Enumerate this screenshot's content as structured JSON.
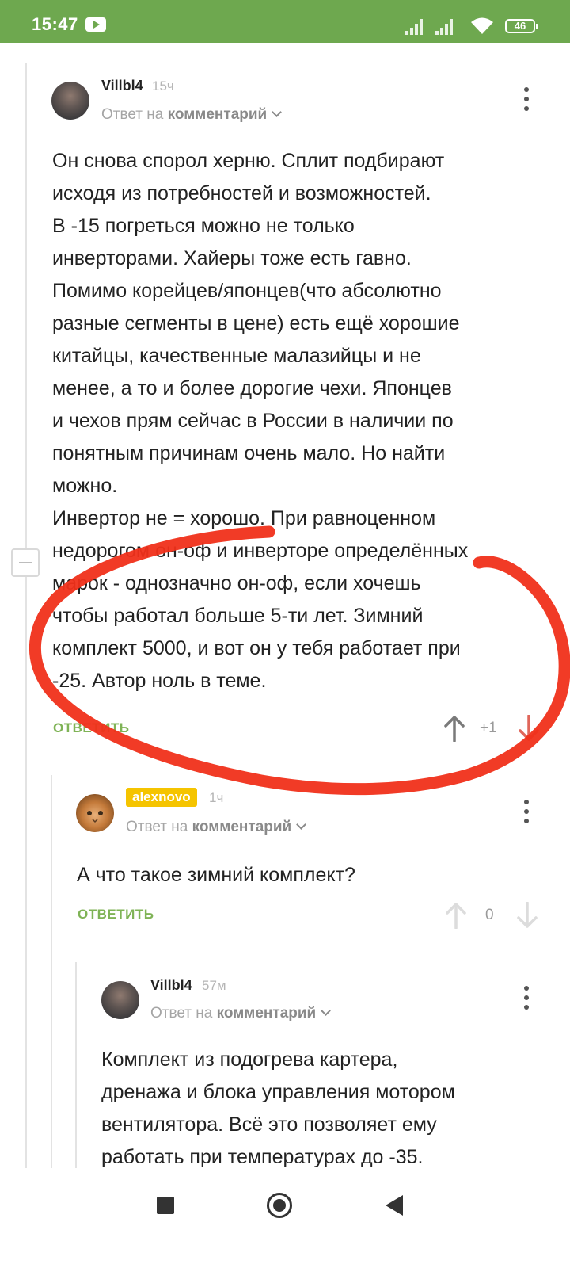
{
  "status_bar": {
    "time": "15:47",
    "battery": "46"
  },
  "comments": [
    {
      "username": "Villbl4",
      "time_ago": "15ч",
      "reply_prefix": "Ответ на",
      "reply_target": "комментарий",
      "text": "Он снова спорол херню. Сплит подбирают\nисходя из потребностей и возможностей.\nВ -15 погреться можно не только\nинверторами. Хайеры тоже есть гавно.\nПомимо корейцев/японцев(что абсолютно\nразные сегменты в цене) есть ещё хорошие\nкитайцы, качественные малазийцы и не\nменее, а то и более дорогие чехи. Японцев\nи  чехов прям сейчас в России в наличии по\nпонятным причинам очень мало. Но найти\nможно.\nИнвертор не = хорошо. При равноценном\nнедорогом он-оф и инверторе определённых\nмарок - однозначно он-оф, если хочешь\nчтобы работал больше 5-ти лет. Зимний\nкомплект 5000, и вот он у тебя работает при\n-25. Автор ноль в теме.",
      "reply_label": "ОТВЕТИТЬ",
      "score": "+1"
    },
    {
      "username": "alexnovo",
      "time_ago": "1ч",
      "reply_prefix": "Ответ на",
      "reply_target": "комментарий",
      "text": "А что такое зимний комплект?",
      "reply_label": "ОТВЕТИТЬ",
      "score": "0"
    },
    {
      "username": "Villbl4",
      "time_ago": "57м",
      "reply_prefix": "Ответ на",
      "reply_target": "комментарий",
      "text": "Комплект из подогрева картера,\nдренажа и блока управления мотором\nвентилятора. Всё это позволяет ему\nработать при температурах до -35."
    }
  ],
  "colors": {
    "status_bar": "#6ea84f",
    "reply_green": "#7fb356",
    "badge_yellow": "#f5c400",
    "annotation_red": "#f0301a"
  },
  "icons": {
    "status": [
      "youtube-icon",
      "signal-icon",
      "wifi-icon",
      "battery-icon"
    ],
    "comment": [
      "avatar",
      "more-options-icon",
      "chevron-down-icon",
      "upvote-arrow-icon",
      "downvote-arrow-icon",
      "collapse-thread-icon"
    ],
    "nav": [
      "recent-apps-icon",
      "home-icon",
      "back-icon"
    ]
  }
}
